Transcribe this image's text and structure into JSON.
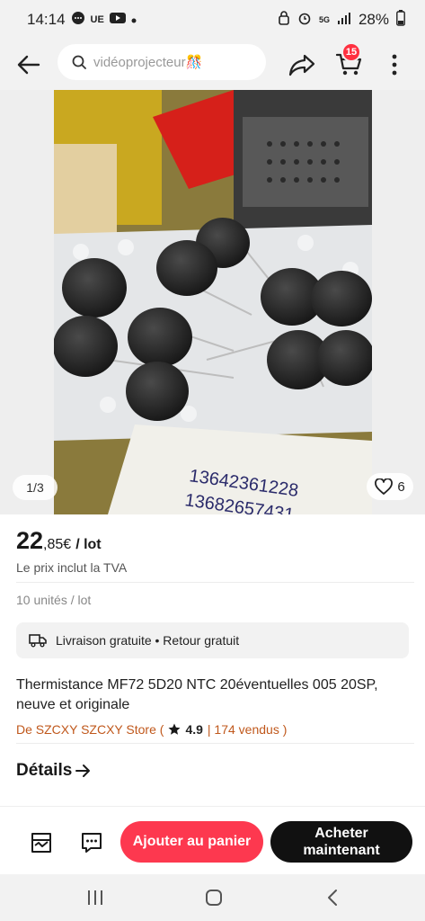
{
  "status_bar": {
    "time": "14:14",
    "carrier_badge": "UE",
    "battery": "28%",
    "network": "5G"
  },
  "header": {
    "search_text": "vidéoprojecteur🎊",
    "cart_count": "15",
    "icons": [
      "back-arrow-icon",
      "search-icon",
      "share-icon",
      "cart-icon",
      "more-vertical-icon"
    ]
  },
  "gallery": {
    "page_indicator": "1/3",
    "likes": "6",
    "photo_caption_lines": [
      "13642361228",
      "13682657431"
    ]
  },
  "product": {
    "price_main": "22",
    "price_cents": ",85€",
    "price_unit": "/ lot",
    "tva_note": "Le prix inclut la TVA",
    "units": "10 unités / lot",
    "delivery": "Livraison gratuite • Retour gratuit",
    "title": "Thermistance MF72 5D20 NTC 20éventuelles 005 20SP, neuve et originale",
    "store_prefix": "De SZCXY SZCXY Store (",
    "store_rating": "4.9",
    "store_sold": "| 174 vendus )",
    "details_label": "Détails"
  },
  "actions": {
    "add_to_cart": "Ajouter au panier",
    "buy_now": "Acheter maintenant"
  },
  "colors": {
    "accent_red": "#fd384f",
    "store_orange": "#c0581c",
    "buy_black": "#111111"
  }
}
